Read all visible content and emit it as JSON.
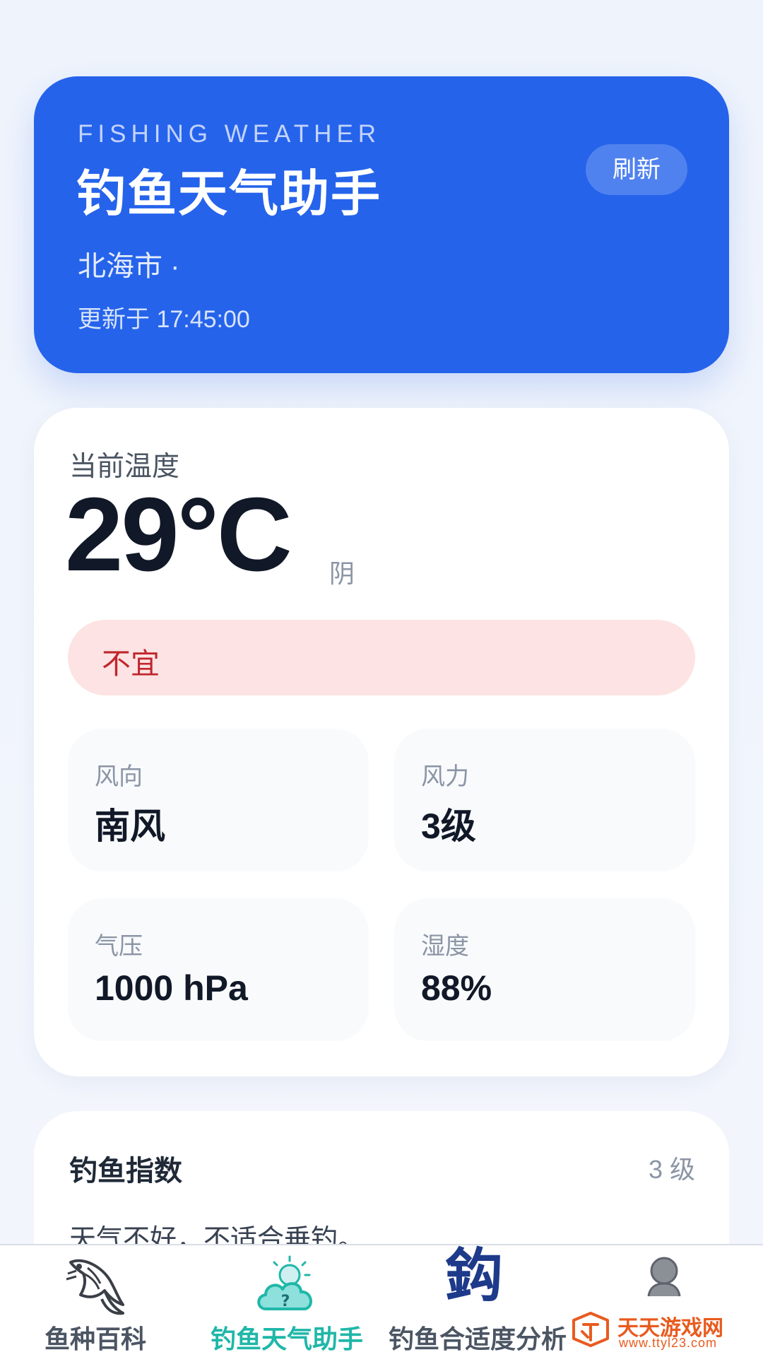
{
  "header": {
    "kicker": "FISHING WEATHER",
    "title": "钓鱼天气助手",
    "location": "北海市 ·",
    "updated": "更新于 17:45:00",
    "refresh_label": "刷新"
  },
  "weather": {
    "temp_label": "当前温度",
    "temperature": "29°C",
    "condition": "阴",
    "suitability": "不宜",
    "metrics": [
      {
        "label": "风向",
        "value": "南风"
      },
      {
        "label": "风力",
        "value": "3级"
      },
      {
        "label": "气压",
        "value": "1000 hPa"
      },
      {
        "label": "湿度",
        "value": "88%"
      }
    ]
  },
  "fishing_index": {
    "title": "钓鱼指数",
    "level": "3 级",
    "description": "天气不好，不适合垂钓。"
  },
  "tabbar": {
    "items": [
      {
        "label": "鱼种百科",
        "icon": "fish-icon",
        "active": false
      },
      {
        "label": "钓鱼天气助手",
        "icon": "weather-cloud-icon",
        "active": true
      },
      {
        "label": "钓鱼合适度分析",
        "icon": "diao-glyph-icon",
        "active": false
      },
      {
        "label": "",
        "icon": "profile-icon",
        "active": false
      }
    ],
    "diao_glyph": "鈎"
  },
  "watermark": {
    "text": "天天游戏网",
    "url": "www.ttyl23.com"
  },
  "colors": {
    "primary": "#2563eb",
    "danger_bg": "#fde3e3",
    "danger_text": "#c0262d",
    "active_tab": "#1fb7a8"
  }
}
